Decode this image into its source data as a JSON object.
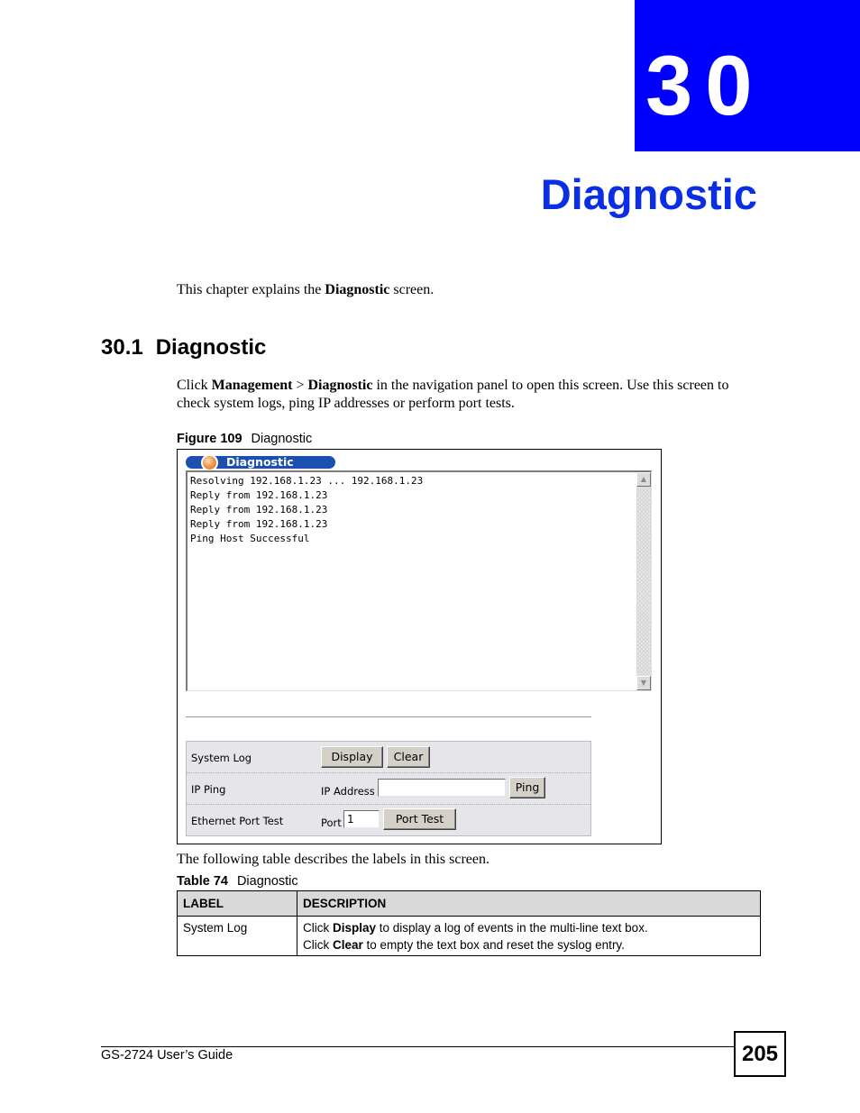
{
  "chapter": {
    "number": "30",
    "title": "Diagnostic",
    "accent_color": "#0000ff"
  },
  "intro": {
    "pre": "This chapter explains the ",
    "bold": "Diagnostic",
    "post": " screen."
  },
  "section": {
    "number": "30.1",
    "title": "Diagnostic"
  },
  "body": {
    "t1": "Click ",
    "b1": "Management",
    "t2": " > ",
    "b2": "Diagnostic",
    "t3": " in the navigation panel to open this screen. Use this screen to check system logs, ping IP addresses or perform port tests."
  },
  "figure": {
    "caption_label": "Figure 109",
    "caption_title": "Diagnostic",
    "screen_title": "Diagnostic",
    "log_lines": [
      "Resolving 192.168.1.23 ... 192.168.1.23",
      "Reply from 192.168.1.23",
      "Reply from 192.168.1.23",
      "Reply from 192.168.1.23",
      "Ping Host Successful"
    ],
    "scroll_up_icon": "▲",
    "scroll_down_icon": "▼",
    "system_log": {
      "label": "System Log",
      "display_button": "Display",
      "clear_button": "Clear"
    },
    "ip_ping": {
      "label": "IP Ping",
      "field_label": "IP Address",
      "field_value": "",
      "ping_button": "Ping"
    },
    "port_test": {
      "label": "Ethernet Port Test",
      "field_label": "Port",
      "field_value": "1",
      "button": "Port Test"
    }
  },
  "table_intro": "The following table describes the labels in this screen.",
  "table": {
    "caption_label": "Table 74",
    "caption_title": "Diagnostic",
    "headers": [
      "LABEL",
      "DESCRIPTION"
    ],
    "rows": [
      {
        "label": "System Log",
        "line1_pre": "Click ",
        "line1_bold": "Display",
        "line1_post": " to display a log of events in the multi-line text box.",
        "line2_pre": "Click ",
        "line2_bold": "Clear",
        "line2_post": " to empty the text box and reset the syslog entry."
      }
    ]
  },
  "footer": {
    "guide": "GS-2724 User’s Guide",
    "page": "205"
  }
}
